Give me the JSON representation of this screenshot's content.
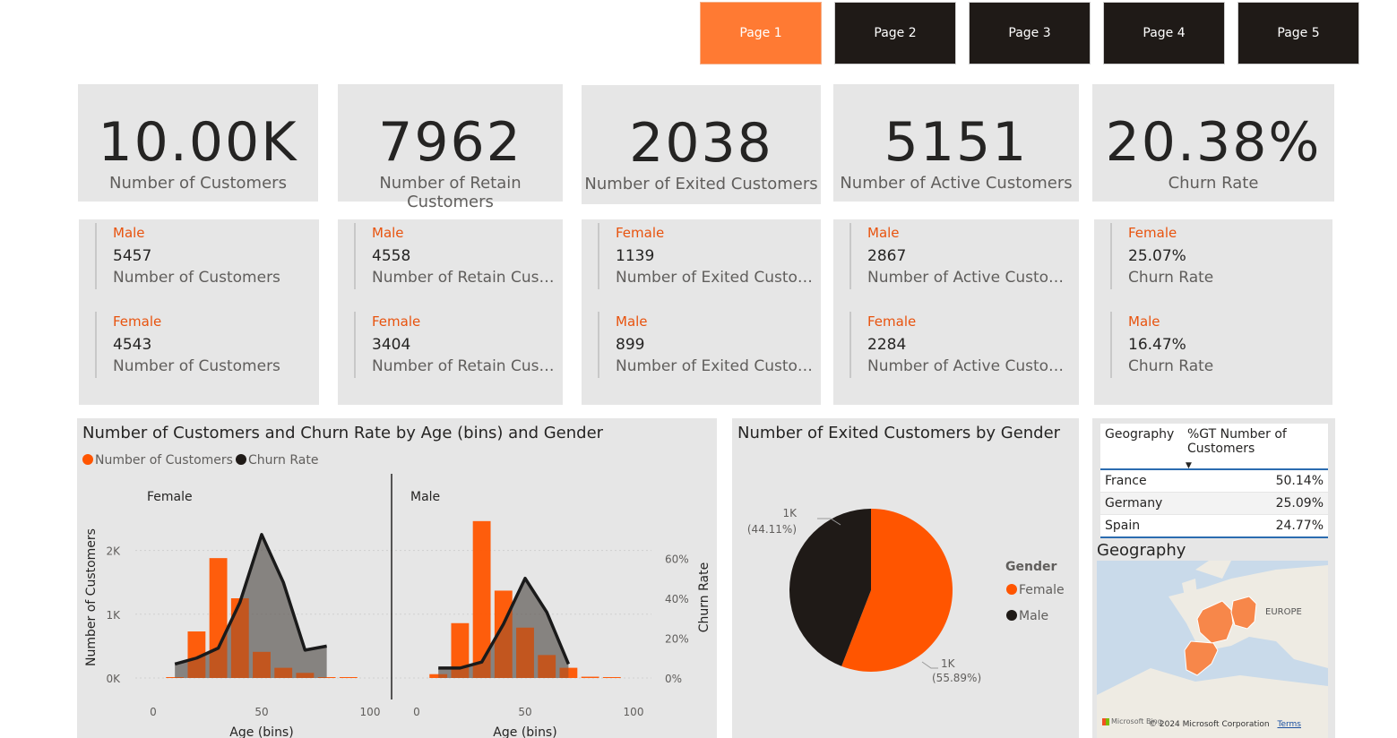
{
  "nav": {
    "pages": [
      "Page 1",
      "Page 2",
      "Page 3",
      "Page 4",
      "Page 5"
    ],
    "active_index": 0
  },
  "kpis": [
    {
      "value": "10.00K",
      "label": "Number of Customers"
    },
    {
      "value": "7962",
      "label": "Number of Retain Customers"
    },
    {
      "value": "2038",
      "label": "Number of Exited Customers"
    },
    {
      "value": "5151",
      "label": "Number of Active Customers"
    },
    {
      "value": "20.38%",
      "label": "Churn Rate"
    }
  ],
  "gender_cards": [
    {
      "rows": [
        {
          "cat": "Male",
          "val": "5457",
          "lbl": "Number of Customers"
        },
        {
          "cat": "Female",
          "val": "4543",
          "lbl": "Number of Customers"
        }
      ]
    },
    {
      "rows": [
        {
          "cat": "Male",
          "val": "4558",
          "lbl": "Number of Retain Custom..."
        },
        {
          "cat": "Female",
          "val": "3404",
          "lbl": "Number of Retain Custom..."
        }
      ]
    },
    {
      "rows": [
        {
          "cat": "Female",
          "val": "1139",
          "lbl": "Number of Exited Customers"
        },
        {
          "cat": "Male",
          "val": "899",
          "lbl": "Number of Exited Customers"
        }
      ]
    },
    {
      "rows": [
        {
          "cat": "Male",
          "val": "2867",
          "lbl": "Number of Active Customers"
        },
        {
          "cat": "Female",
          "val": "2284",
          "lbl": "Number of Active Customers"
        }
      ]
    },
    {
      "rows": [
        {
          "cat": "Female",
          "val": "25.07%",
          "lbl": "Churn Rate"
        },
        {
          "cat": "Male",
          "val": "16.47%",
          "lbl": "Churn Rate"
        }
      ]
    }
  ],
  "colors": {
    "accent": "#ff5500",
    "dark": "#1f1a17",
    "nav_active": "#ff7a33",
    "card_bg": "#e6e6e6"
  },
  "chart_data": [
    {
      "type": "bar",
      "title": "Number of Customers and Churn Rate by Age (bins) and Gender",
      "legend": [
        "Number of Customers",
        "Churn Rate"
      ],
      "legend_position": "top-left",
      "xlabel": "Age (bins)",
      "ylabel": "Number of Customers",
      "y2label": "Churn Rate",
      "ylim": [
        0,
        2500
      ],
      "y2lim": [
        0,
        0.8
      ],
      "xlim": [
        0,
        100
      ],
      "xticks": [
        "0",
        "50",
        "100"
      ],
      "yticks": [
        "0K",
        "1K",
        "2K"
      ],
      "y2ticks": [
        "0%",
        "20%",
        "40%",
        "60%"
      ],
      "panels": [
        {
          "name": "Female",
          "x": [
            10,
            20,
            30,
            40,
            50,
            60,
            70,
            80,
            90
          ],
          "customers": [
            10,
            730,
            1880,
            1250,
            410,
            160,
            80,
            10,
            0
          ],
          "churn_rate": [
            0.07,
            0.1,
            0.15,
            0.38,
            0.72,
            0.48,
            0.14,
            0.16,
            null
          ]
        },
        {
          "name": "Male",
          "x": [
            10,
            20,
            30,
            40,
            50,
            60,
            70,
            80,
            90
          ],
          "customers": [
            60,
            860,
            2460,
            1370,
            790,
            360,
            160,
            20,
            10
          ],
          "churn_rate": [
            0.05,
            0.05,
            0.08,
            0.27,
            0.5,
            0.33,
            0.07,
            null,
            null
          ]
        }
      ]
    },
    {
      "type": "pie",
      "title": "Number of Exited Customers by Gender",
      "legend_title": "Gender",
      "legend_position": "right",
      "slices": [
        {
          "name": "Female",
          "value": 1139,
          "label": "1K",
          "pct": "(55.89%)",
          "color": "#ff5500"
        },
        {
          "name": "Male",
          "value": 899,
          "label": "1K",
          "pct": "(44.11%)",
          "color": "#1f1a17"
        }
      ]
    }
  ],
  "geo_table": {
    "headers": [
      "Geography",
      "%GT Number of Customers"
    ],
    "rows": [
      [
        "France",
        "50.14%"
      ],
      [
        "Germany",
        "25.09%"
      ],
      [
        "Spain",
        "24.77%"
      ]
    ]
  },
  "map": {
    "title": "Geography",
    "region_label": "EUROPE",
    "copyright": "© 2024 Microsoft Corporation",
    "terms": "Terms",
    "brand": "Microsoft Bing"
  }
}
